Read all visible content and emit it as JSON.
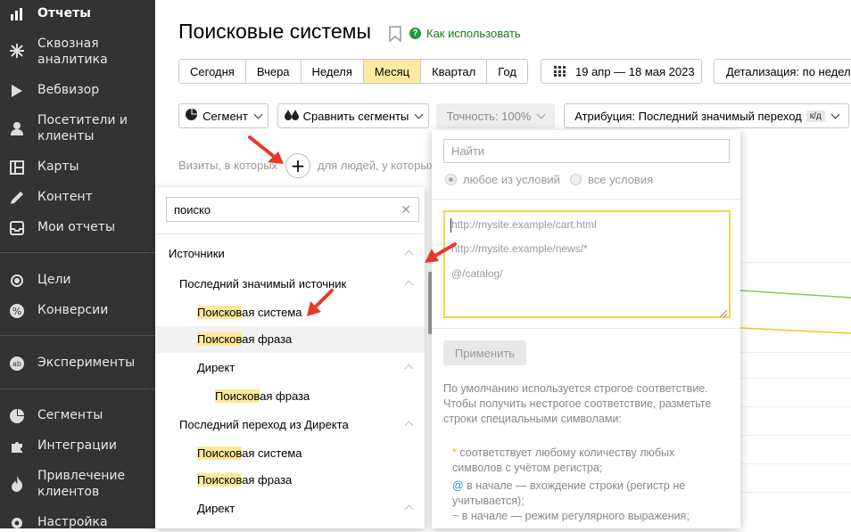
{
  "sidebar": {
    "items": [
      {
        "label": "Отчеты",
        "icon": "bar-chart-icon",
        "active": true
      },
      {
        "label": "Сквозная аналитика",
        "icon": "asterisk-icon"
      },
      {
        "label": "Вебвизор",
        "icon": "play-icon"
      },
      {
        "label": "Посетители и клиенты",
        "icon": "user-icon"
      },
      {
        "label": "Карты",
        "icon": "map-icon"
      },
      {
        "label": "Контент",
        "icon": "pencil-icon"
      },
      {
        "label": "Мои отчеты",
        "icon": "inbox-icon"
      },
      {
        "label": "Цели",
        "icon": "target-icon"
      },
      {
        "label": "Конверсии",
        "icon": "percent-icon"
      },
      {
        "label": "Эксперименты",
        "icon": "ab-icon"
      },
      {
        "label": "Сегменты",
        "icon": "pie-icon"
      },
      {
        "label": "Интеграции",
        "icon": "puzzle-icon"
      },
      {
        "label": "Привлечение клиентов",
        "icon": "flame-icon"
      },
      {
        "label": "Настройка",
        "icon": "gear-icon"
      }
    ]
  },
  "header": {
    "title": "Поисковые системы",
    "howto": "Как использовать"
  },
  "periods": [
    "Сегодня",
    "Вчера",
    "Неделя",
    "Месяц",
    "Квартал",
    "Год"
  ],
  "selected_period": "Месяц",
  "date_range": "19 апр — 18 мая 2023",
  "detail": "Детализация: по недел",
  "toolbar": {
    "segment": "Сегмент",
    "compare": "Сравнить сегменты",
    "accuracy": "Точность: 100%",
    "attribution": "Атрибуция: Последний значимый переход",
    "attribution_badge": "к/д"
  },
  "filter_row": {
    "left": "Визиты, в которых",
    "right": "для людей, у которых",
    "plus": "+"
  },
  "left_panel": {
    "search_value": "поиско",
    "tree": [
      {
        "pre": "",
        "hl": "",
        "post": "Источники"
      },
      {
        "pre": "",
        "hl": "",
        "post": "Последний значимый источник"
      },
      {
        "pre": "",
        "hl": "Поисков",
        "post": "ая система"
      },
      {
        "pre": "",
        "hl": "Поисков",
        "post": "ая фраза"
      },
      {
        "pre": "",
        "hl": "",
        "post": "Директ"
      },
      {
        "pre": "",
        "hl": "Поисков",
        "post": "ая фраза"
      },
      {
        "pre": "",
        "hl": "",
        "post": "Последний переход из Директа"
      },
      {
        "pre": "",
        "hl": "Поисков",
        "post": "ая система"
      },
      {
        "pre": "",
        "hl": "Поисков",
        "post": "ая фраза"
      },
      {
        "pre": "",
        "hl": "",
        "post": "Директ"
      }
    ]
  },
  "right_panel": {
    "find_placeholder": "Найти",
    "radio_any": "любое из условий",
    "radio_all": "все условия",
    "textarea_lines": [
      "http://mysite.example/cart.html",
      "http://mysite.example/news/*",
      "@/catalog/"
    ],
    "apply": "Применить",
    "help_intro": [
      "По умолчанию используется строгое соответствие.",
      "Чтобы получить нестрогое соответствие, разметьте",
      "строки специальными символами:"
    ],
    "help_star_sym": "*",
    "help_star": [
      " соответствует любому количеству любых",
      "символов с учётом регистра;"
    ],
    "help_at_sym": "@",
    "help_at": [
      " в начале — вхождение строки (регистр не",
      "учитывается);"
    ],
    "help_tilde_sym": "~",
    "help_tilde": " в начале — режим регулярного выражения;"
  },
  "colors": {
    "sidebar_bg": "#333333",
    "selected_period": "#ffeba0",
    "highlight": "#fde99a",
    "textarea_border": "#f2d64b",
    "arrow": "#e8382a"
  }
}
